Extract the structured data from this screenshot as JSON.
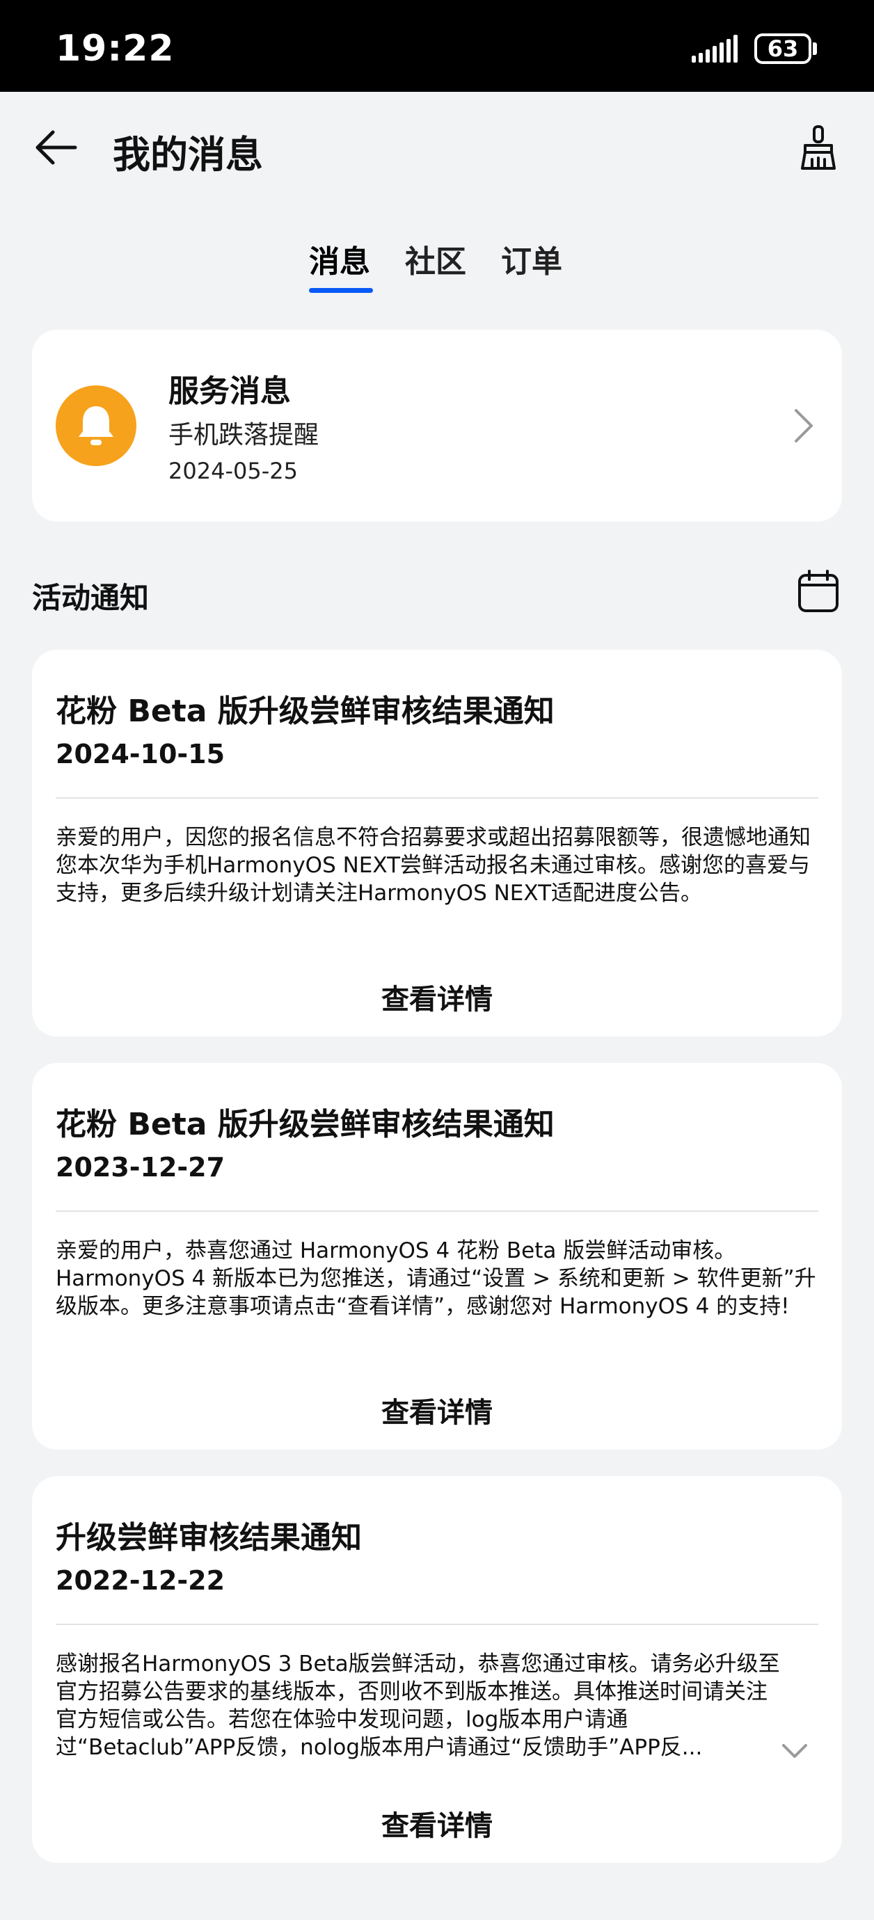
{
  "status_bar": {
    "time": "19:22",
    "battery": "63",
    "icons": [
      "signal-icon",
      "battery-icon"
    ]
  },
  "header": {
    "title": "我的消息",
    "back_icon": "back-arrow-icon",
    "clear_icon": "clean-brush-icon"
  },
  "tabs": [
    {
      "label": "消息",
      "active": true
    },
    {
      "label": "社区",
      "active": false
    },
    {
      "label": "订单",
      "active": false
    }
  ],
  "accent_color": "#0a59f7",
  "service": {
    "title": "服务消息",
    "subtitle": "手机跌落提醒",
    "date": "2024-05-25",
    "icon": "bell-icon",
    "icon_color": "#f7a21c"
  },
  "activity": {
    "section_title": "活动通知",
    "calendar_icon": "calendar-icon",
    "notices": [
      {
        "title": "花粉 Beta 版升级尝鲜审核结果通知",
        "date": "2024-10-15",
        "body": "亲爱的用户，因您的报名信息不符合招募要求或超出招募限额等，很遗憾地通知您本次华为手机HarmonyOS NEXT尝鲜活动报名未通过审核。感谢您的喜爱与支持，更多后续升级计划请关注HarmonyOS NEXT适配进度公告。",
        "link": "查看详情"
      },
      {
        "title": "花粉 Beta 版升级尝鲜审核结果通知",
        "date": "2023-12-27",
        "body": "亲爱的用户，恭喜您通过 HarmonyOS 4 花粉 Beta 版尝鲜活动审核。HarmonyOS 4 新版本已为您推送，请通过“设置 > 系统和更新 > 软件更新”升级版本。更多注意事项请点击“查看详情”，感谢您对 HarmonyOS 4 的支持!",
        "link": "查看详情"
      },
      {
        "title": "升级尝鲜审核结果通知",
        "date": "2022-12-22",
        "body": "感谢报名HarmonyOS 3 Beta版尝鲜活动，恭喜您通过审核。请务必升级至官方招募公告要求的基线版本，否则收不到版本推送。具体推送时间请关注官方短信或公告。若您在体验中发现问题，log版本用户请通过“Betaclub”APP反馈，nolog版本用户请通过“反馈助手”APP反...",
        "link": "查看详情"
      }
    ]
  }
}
